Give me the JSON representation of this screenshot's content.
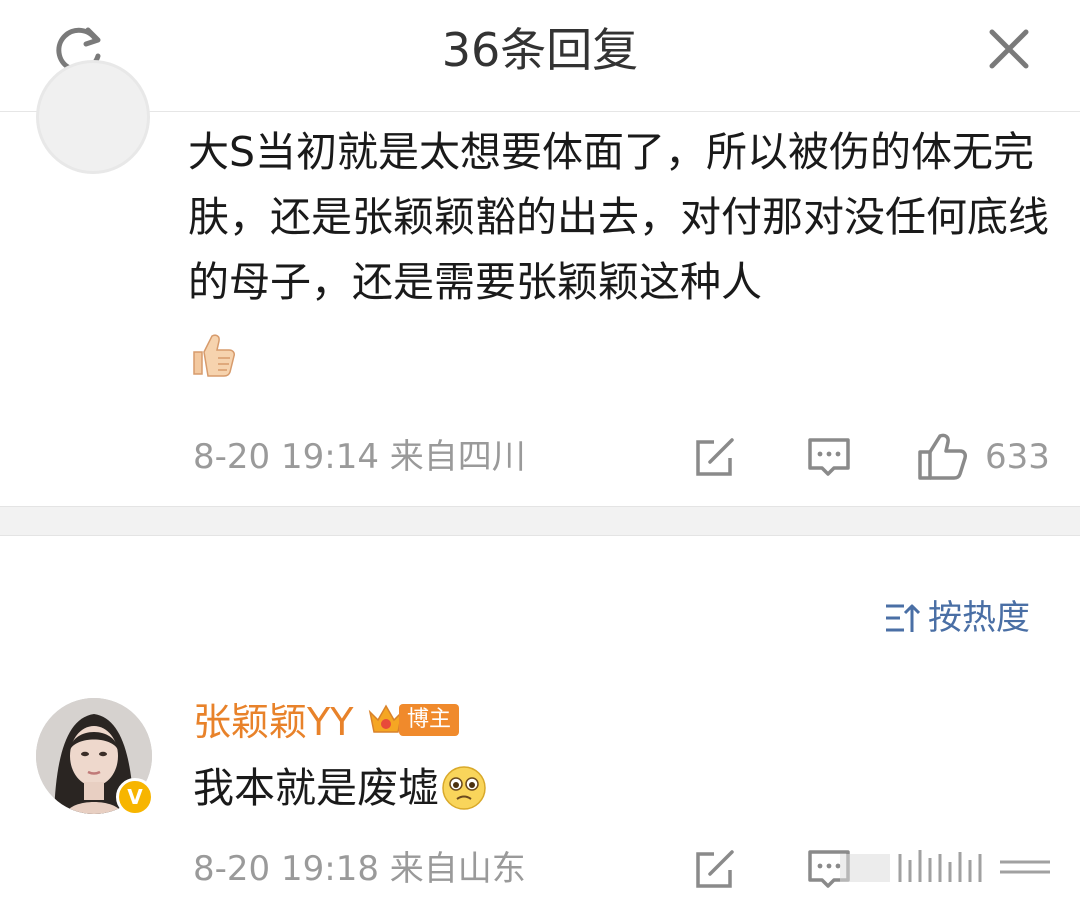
{
  "header": {
    "title": "36条回复",
    "refresh_icon": "refresh-icon",
    "close_icon": "close-icon"
  },
  "comment1": {
    "text": "大S当初就是太想要体面了，所以被伤的体无完肤，还是张颖颖豁的出去，对付那对没任何底线的母子，还是需要张颖颖这种人",
    "emoji": "thumbs-up-emoji",
    "time": "8-20 19:14 来自四川",
    "likes": "633"
  },
  "sort": {
    "label": "按热度",
    "icon": "sort-icon",
    "color": "#4a6fa5"
  },
  "comment2": {
    "username": "张颖颖YY",
    "badge": "博主",
    "text": "我本就是废墟",
    "emoji": "sad-emoji",
    "time": "8-20 19:18 来自山东",
    "username_color": "#e8822a",
    "verified_color": "#f7b500"
  }
}
